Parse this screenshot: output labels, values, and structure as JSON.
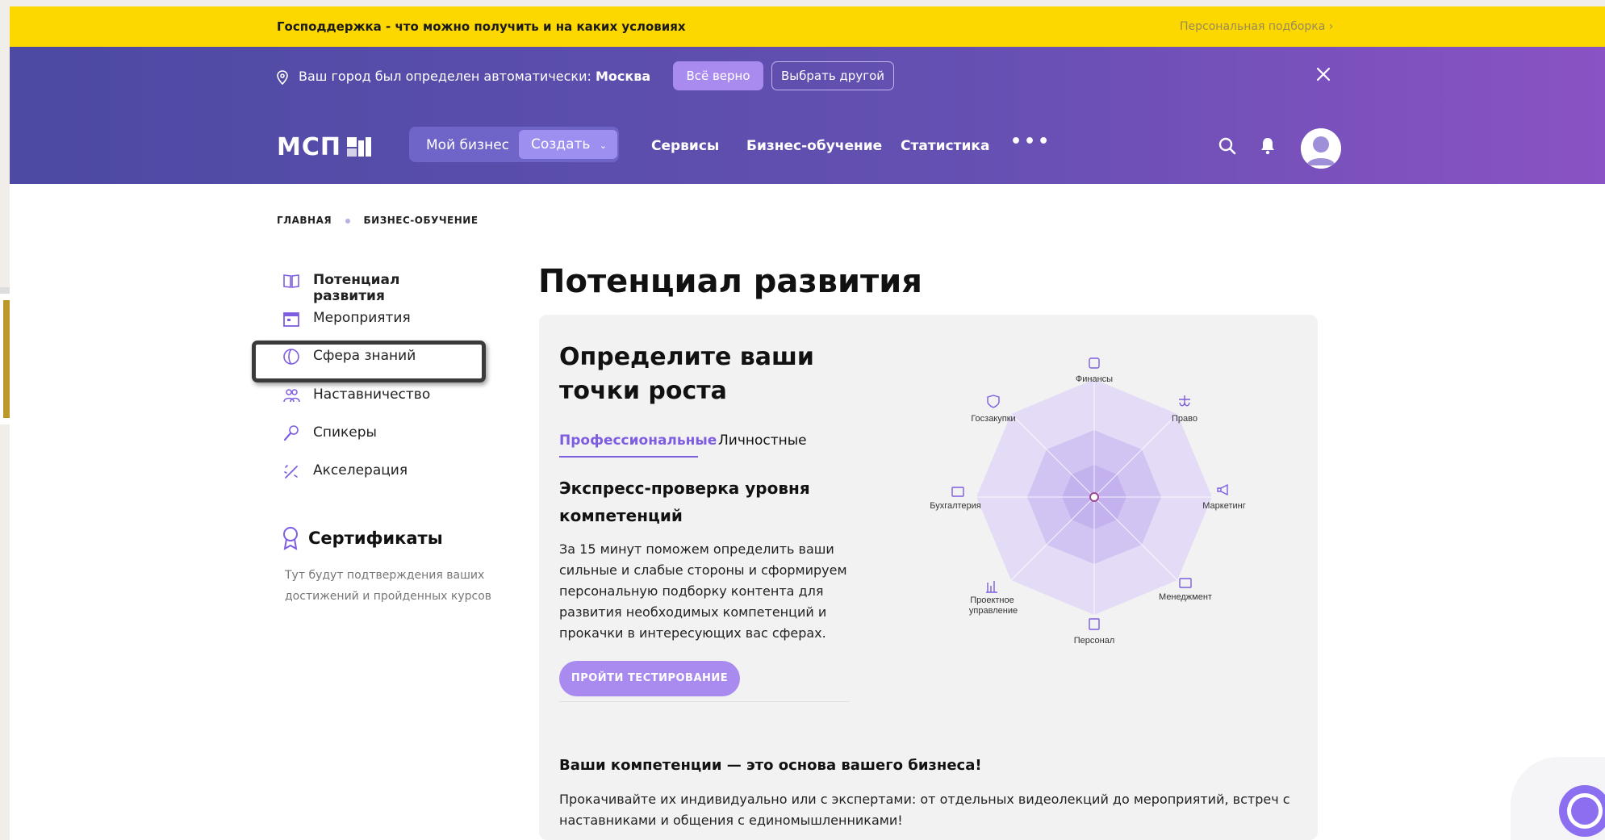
{
  "topbar": {
    "promo": "Господдержка - что можно получить и на каких условиях",
    "personal": "Персональная подборка ›"
  },
  "city": {
    "text": "Ваш город был определен автоматически:",
    "name": "Москва",
    "confirm": "Всё верно",
    "choose": "Выбрать другой"
  },
  "nav": {
    "logo": "МСП",
    "my_business": "Мой бизнес",
    "create": "Создать",
    "services": "Сервисы",
    "learning": "Бизнес-обучение",
    "stats": "Статистика",
    "more": "•••"
  },
  "breadcrumb": [
    "ГЛАВНАЯ",
    "БИЗНЕС-ОБУЧЕНИЕ"
  ],
  "sidebar": {
    "items": [
      {
        "label": "Потенциал развития"
      },
      {
        "label": "Мероприятия"
      },
      {
        "label": "Сфера знаний"
      },
      {
        "label": "Наставничество"
      },
      {
        "label": "Спикеры"
      },
      {
        "label": "Акселерация"
      }
    ],
    "cert_title": "Сертификаты",
    "cert_text": "Тут будут подтверждения ваших достижений и пройденных курсов"
  },
  "main": {
    "title": "Потенциал развития",
    "card_title": "Определите ваши точки роста",
    "tabs": [
      "Профессиональные",
      "Личностные"
    ],
    "sub_title": "Экспресс-проверка уровня компетенций",
    "desc": "За 15 минут поможем определить ваши сильные и слабые стороны и сформируем персональную подборку контента для развития необходимых компетенций и прокачки в интересующих вас сферах.",
    "cta": "ПРОЙТИ ТЕСТИРОВАНИЕ",
    "bottom_title": "Ваши компетенции — это основа вашего бизнеса!",
    "bottom_text": "Прокачивайте их индивидуально или с экспертами: от отдельных видеолекций до мероприятий, встреч с наставниками и общения с единомышленниками!"
  },
  "radar": {
    "labels": [
      "Финансы",
      "Право",
      "Маркетинг",
      "Менеджмент",
      "Персонал",
      "Проектное управление",
      "Бухгалтерия",
      "Госзакупки"
    ]
  },
  "colors": {
    "topbar": "#fdd800",
    "accent": "#7e5de0",
    "button": "#a98bf0"
  }
}
